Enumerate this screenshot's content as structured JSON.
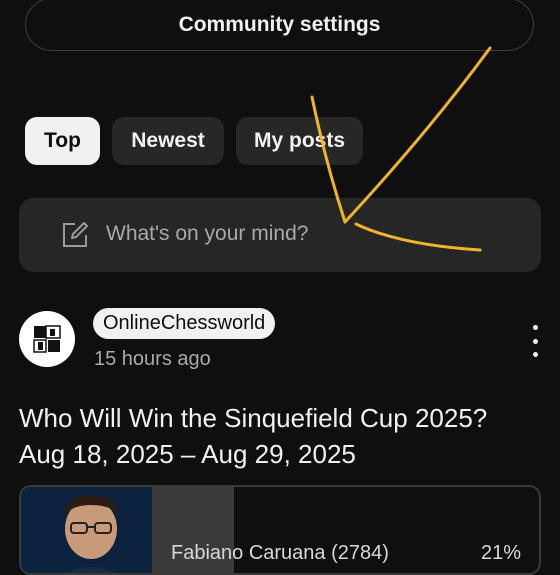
{
  "header": {
    "community_settings_label": "Community settings"
  },
  "filters": {
    "selected": "Top",
    "chips": [
      {
        "label": "Top"
      },
      {
        "label": "Newest"
      },
      {
        "label": "My posts"
      }
    ]
  },
  "composer": {
    "placeholder": "What's on your mind?",
    "icon": "edit-icon"
  },
  "post": {
    "channel_name": "OnlineChessworld",
    "time_ago": "15 hours ago",
    "title": "Who Will Win the Sinquefield Cup 2025? Aug 18, 2025 – Aug 29, 2025",
    "poll": {
      "options": [
        {
          "label": "Fabiano Caruana (2784)",
          "percent_label": "21%",
          "percent": 21
        }
      ]
    }
  },
  "colors": {
    "background": "#0f0f0f",
    "chip_selected": "#f1f1f1",
    "chip_unselected": "#272727",
    "annotation": "#f0b429"
  }
}
